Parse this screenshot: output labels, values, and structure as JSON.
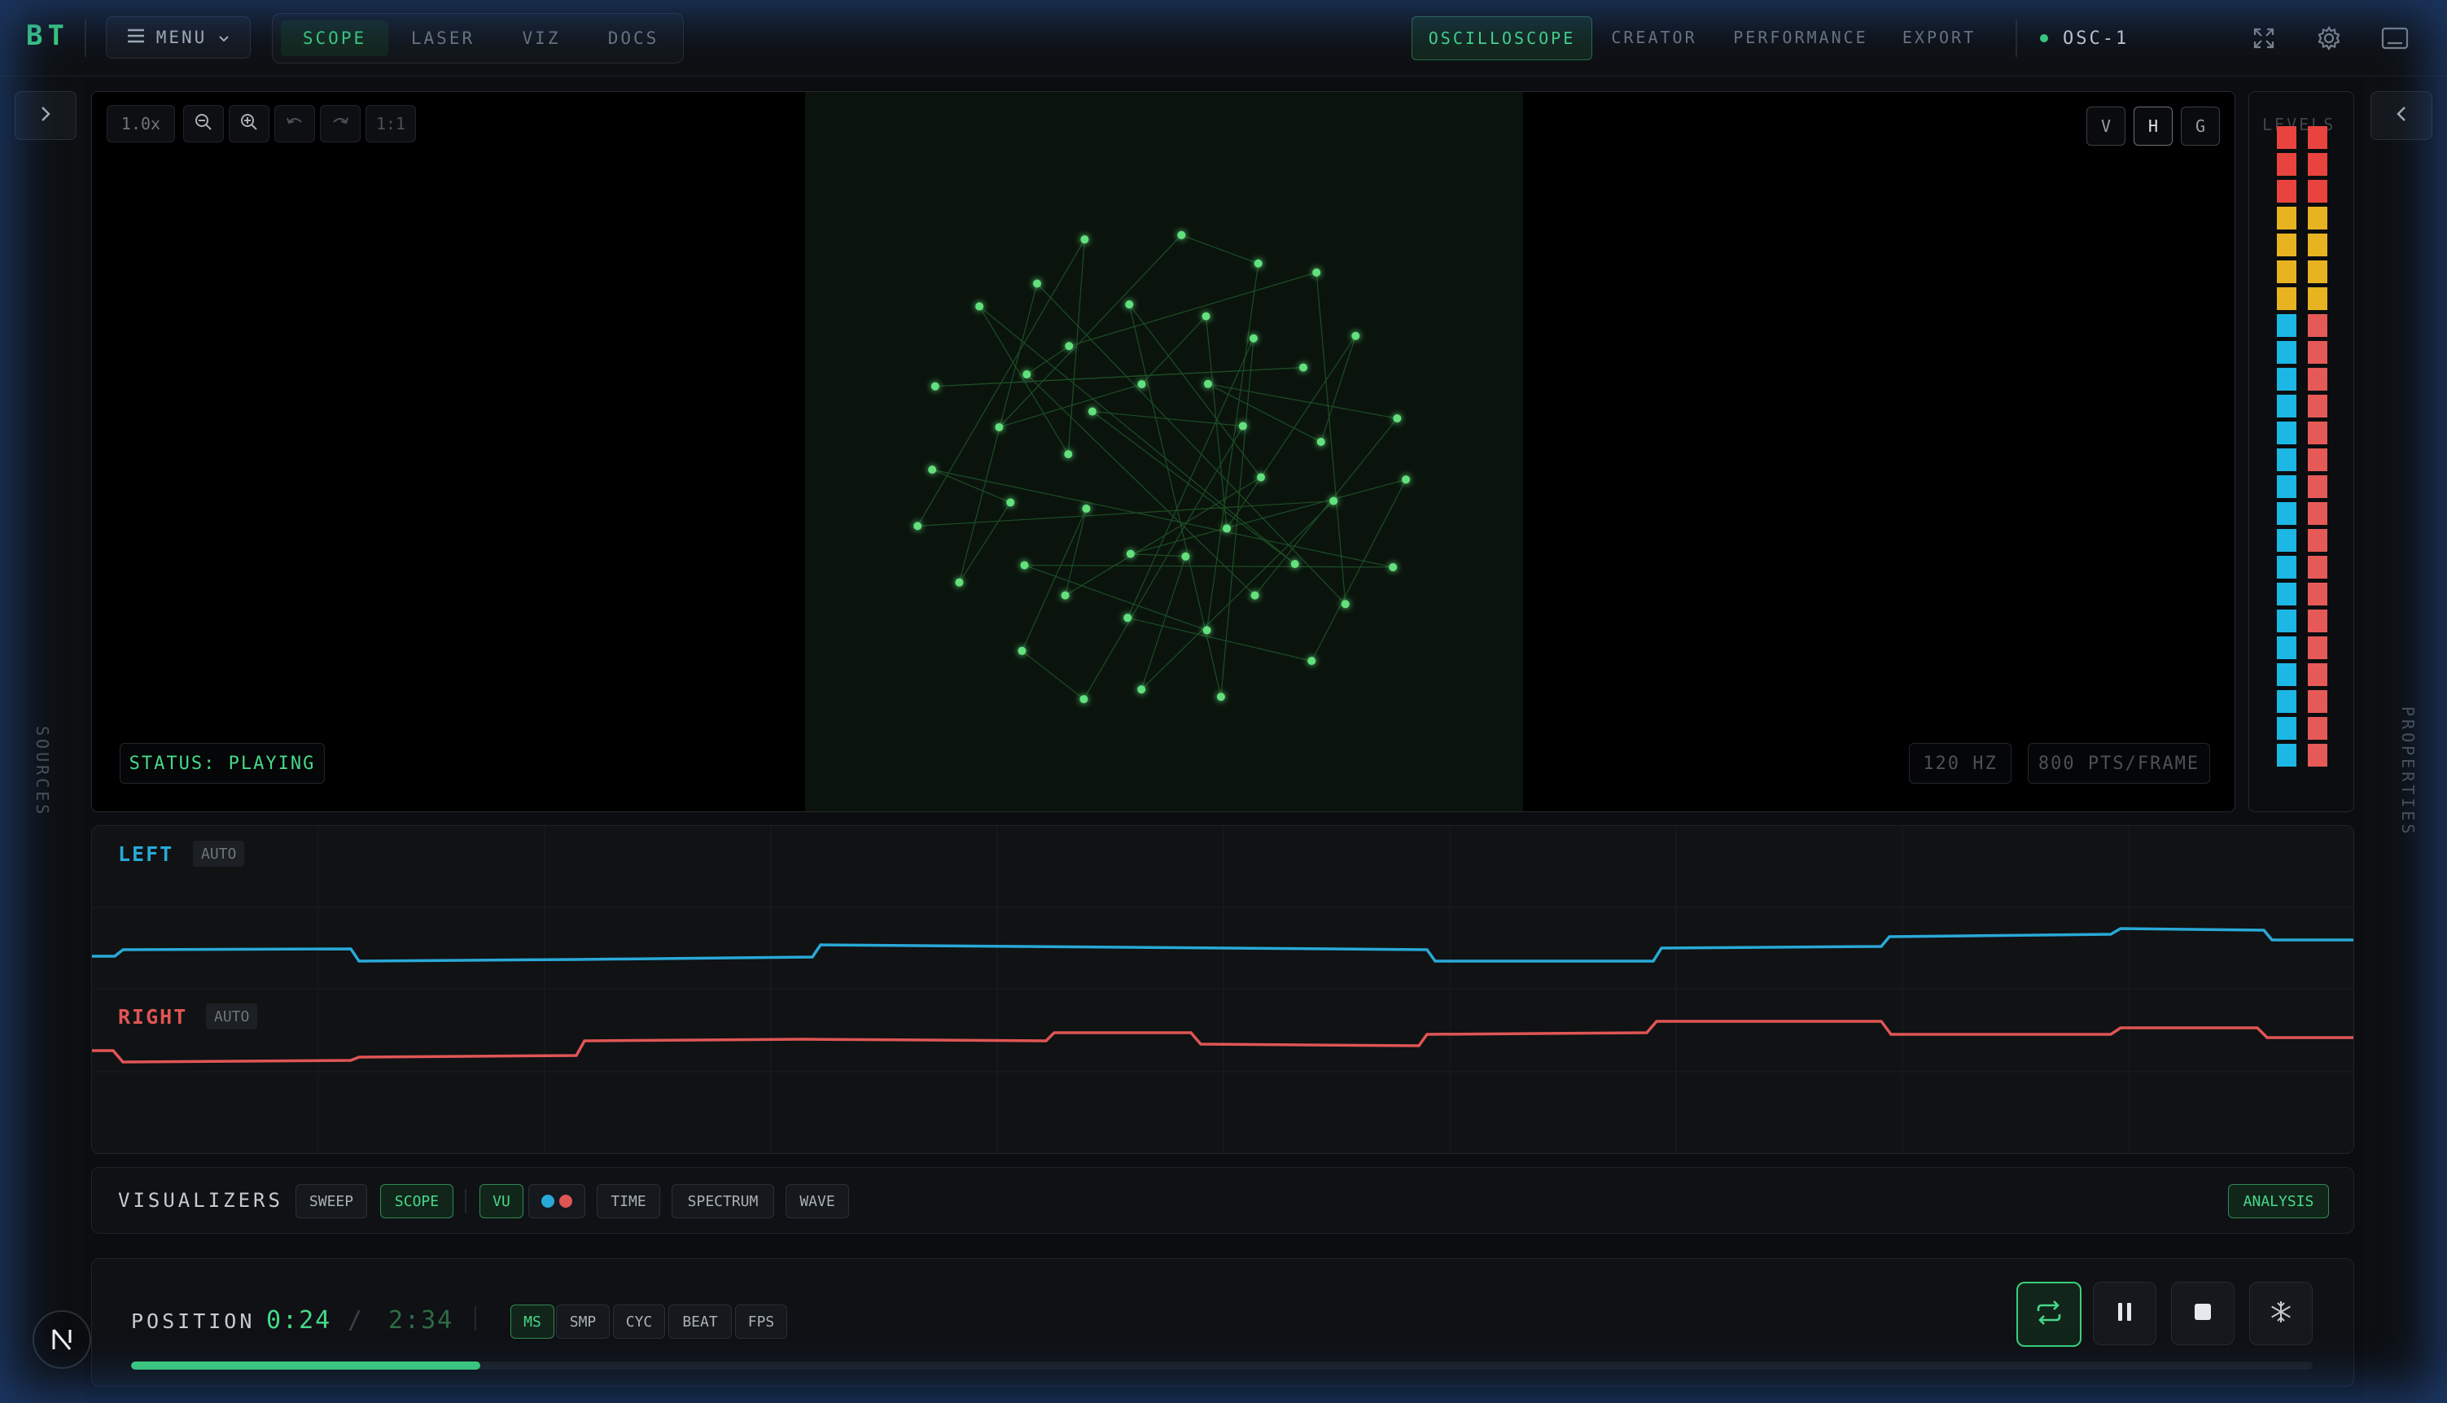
{
  "app": {
    "logo": "BT"
  },
  "topbar": {
    "menu_label": "MENU",
    "nav_tabs": [
      {
        "label": "SCOPE",
        "active": true
      },
      {
        "label": "LASER",
        "active": false
      },
      {
        "label": "VIZ",
        "active": false
      },
      {
        "label": "DOCS",
        "active": false
      }
    ],
    "mode_tabs": [
      {
        "label": "OSCILLOSCOPE",
        "active": true
      },
      {
        "label": "CREATOR",
        "active": false
      },
      {
        "label": "PERFORMANCE",
        "active": false
      },
      {
        "label": "EXPORT",
        "active": false
      }
    ],
    "device": "OSC-1",
    "device_status_color": "#3bd07c",
    "icons": [
      "fullscreen-icon",
      "gear-icon",
      "panel-icon"
    ]
  },
  "sidebars": {
    "left_label": "SOURCES",
    "right_label": "PROPERTIES"
  },
  "scope": {
    "zoom_level": "1.0x",
    "reset_label": "1:1",
    "view_buttons": [
      "V",
      "H",
      "G"
    ],
    "status": "STATUS: PLAYING",
    "rate": "120 HZ",
    "points": "800 PTS/FRAME",
    "trace_color": "#63e07e"
  },
  "meter": {
    "label": "LEVELS",
    "left_channel_level": 1.0,
    "right_channel_level": 1.0,
    "colors": {
      "peak": "#e8433e",
      "warn": "#e8b320",
      "normal": "#1cb7e4",
      "right": "#e55a57"
    }
  },
  "waveforms": {
    "left": {
      "label": "LEFT",
      "mode": "AUTO",
      "color": "#29a9d8"
    },
    "right": {
      "label": "RIGHT",
      "mode": "AUTO",
      "color": "#e05555"
    }
  },
  "visualizers": {
    "title": "VISUALIZERS",
    "buttons": [
      {
        "label": "SWEEP",
        "active": false
      },
      {
        "label": "SCOPE",
        "active": true
      },
      {
        "label": "VU",
        "active": true
      },
      {
        "label": "TIME",
        "active": false
      },
      {
        "label": "SPECTRUM",
        "active": false
      },
      {
        "label": "WAVE",
        "active": false
      }
    ],
    "analysis_label": "ANALYSIS"
  },
  "position": {
    "label": "POSITION",
    "current": "0:24",
    "separator": "/",
    "total": "2:34",
    "units": [
      {
        "label": "MS",
        "active": true
      },
      {
        "label": "SMP",
        "active": false
      },
      {
        "label": "CYC",
        "active": false
      },
      {
        "label": "BEAT",
        "active": false
      },
      {
        "label": "FPS",
        "active": false
      }
    ],
    "progress": 0.16,
    "progress_color": "#3bd07c"
  }
}
